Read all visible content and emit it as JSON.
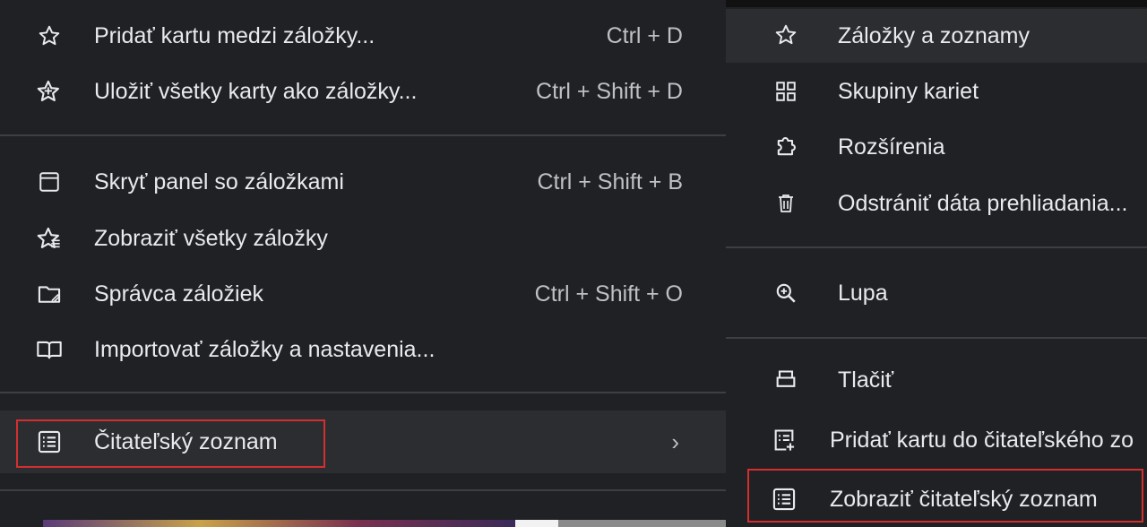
{
  "left_menu": {
    "items": [
      {
        "label": "Pridať kartu medzi záložky...",
        "shortcut": "Ctrl + D",
        "icon": "star-icon"
      },
      {
        "label": "Uložiť všetky karty ako záložky...",
        "shortcut": "Ctrl + Shift + D",
        "icon": "star-plus-icon"
      },
      {
        "label": "Skryť panel so záložkami",
        "shortcut": "Ctrl + Shift + B",
        "icon": "panel-icon"
      },
      {
        "label": "Zobraziť všetky záložky",
        "shortcut": "",
        "icon": "star-list-icon"
      },
      {
        "label": "Správca záložiek",
        "shortcut": "Ctrl + Shift + O",
        "icon": "folder-edit-icon"
      },
      {
        "label": "Importovať záložky a nastavenia...",
        "shortcut": "",
        "icon": "book-icon"
      },
      {
        "label": "Čitateľský zoznam",
        "shortcut": "",
        "icon": "reading-list-icon",
        "has_submenu": true
      }
    ]
  },
  "right_menu": {
    "items": [
      {
        "label": "Záložky a zoznamy",
        "icon": "star-icon"
      },
      {
        "label": "Skupiny kariet",
        "icon": "grid-icon"
      },
      {
        "label": "Rozšírenia",
        "icon": "puzzle-icon"
      },
      {
        "label": "Odstrániť dáta prehliadania...",
        "icon": "trash-icon"
      },
      {
        "label": "Lupa",
        "icon": "zoom-icon"
      },
      {
        "label": "Tlačiť",
        "icon": "printer-icon"
      }
    ]
  },
  "sub_menu": {
    "items": [
      {
        "label": "Pridať kartu do čitateľského zo",
        "icon": "add-to-reading-list-icon"
      },
      {
        "label": "Zobraziť čitateľský zoznam",
        "icon": "reading-list-icon"
      }
    ]
  },
  "colors": {
    "background": "#202124",
    "highlight": "#2c2d30",
    "text": "#e8eaed",
    "separator": "#3c4043",
    "annotation_red": "#d32f2f"
  }
}
